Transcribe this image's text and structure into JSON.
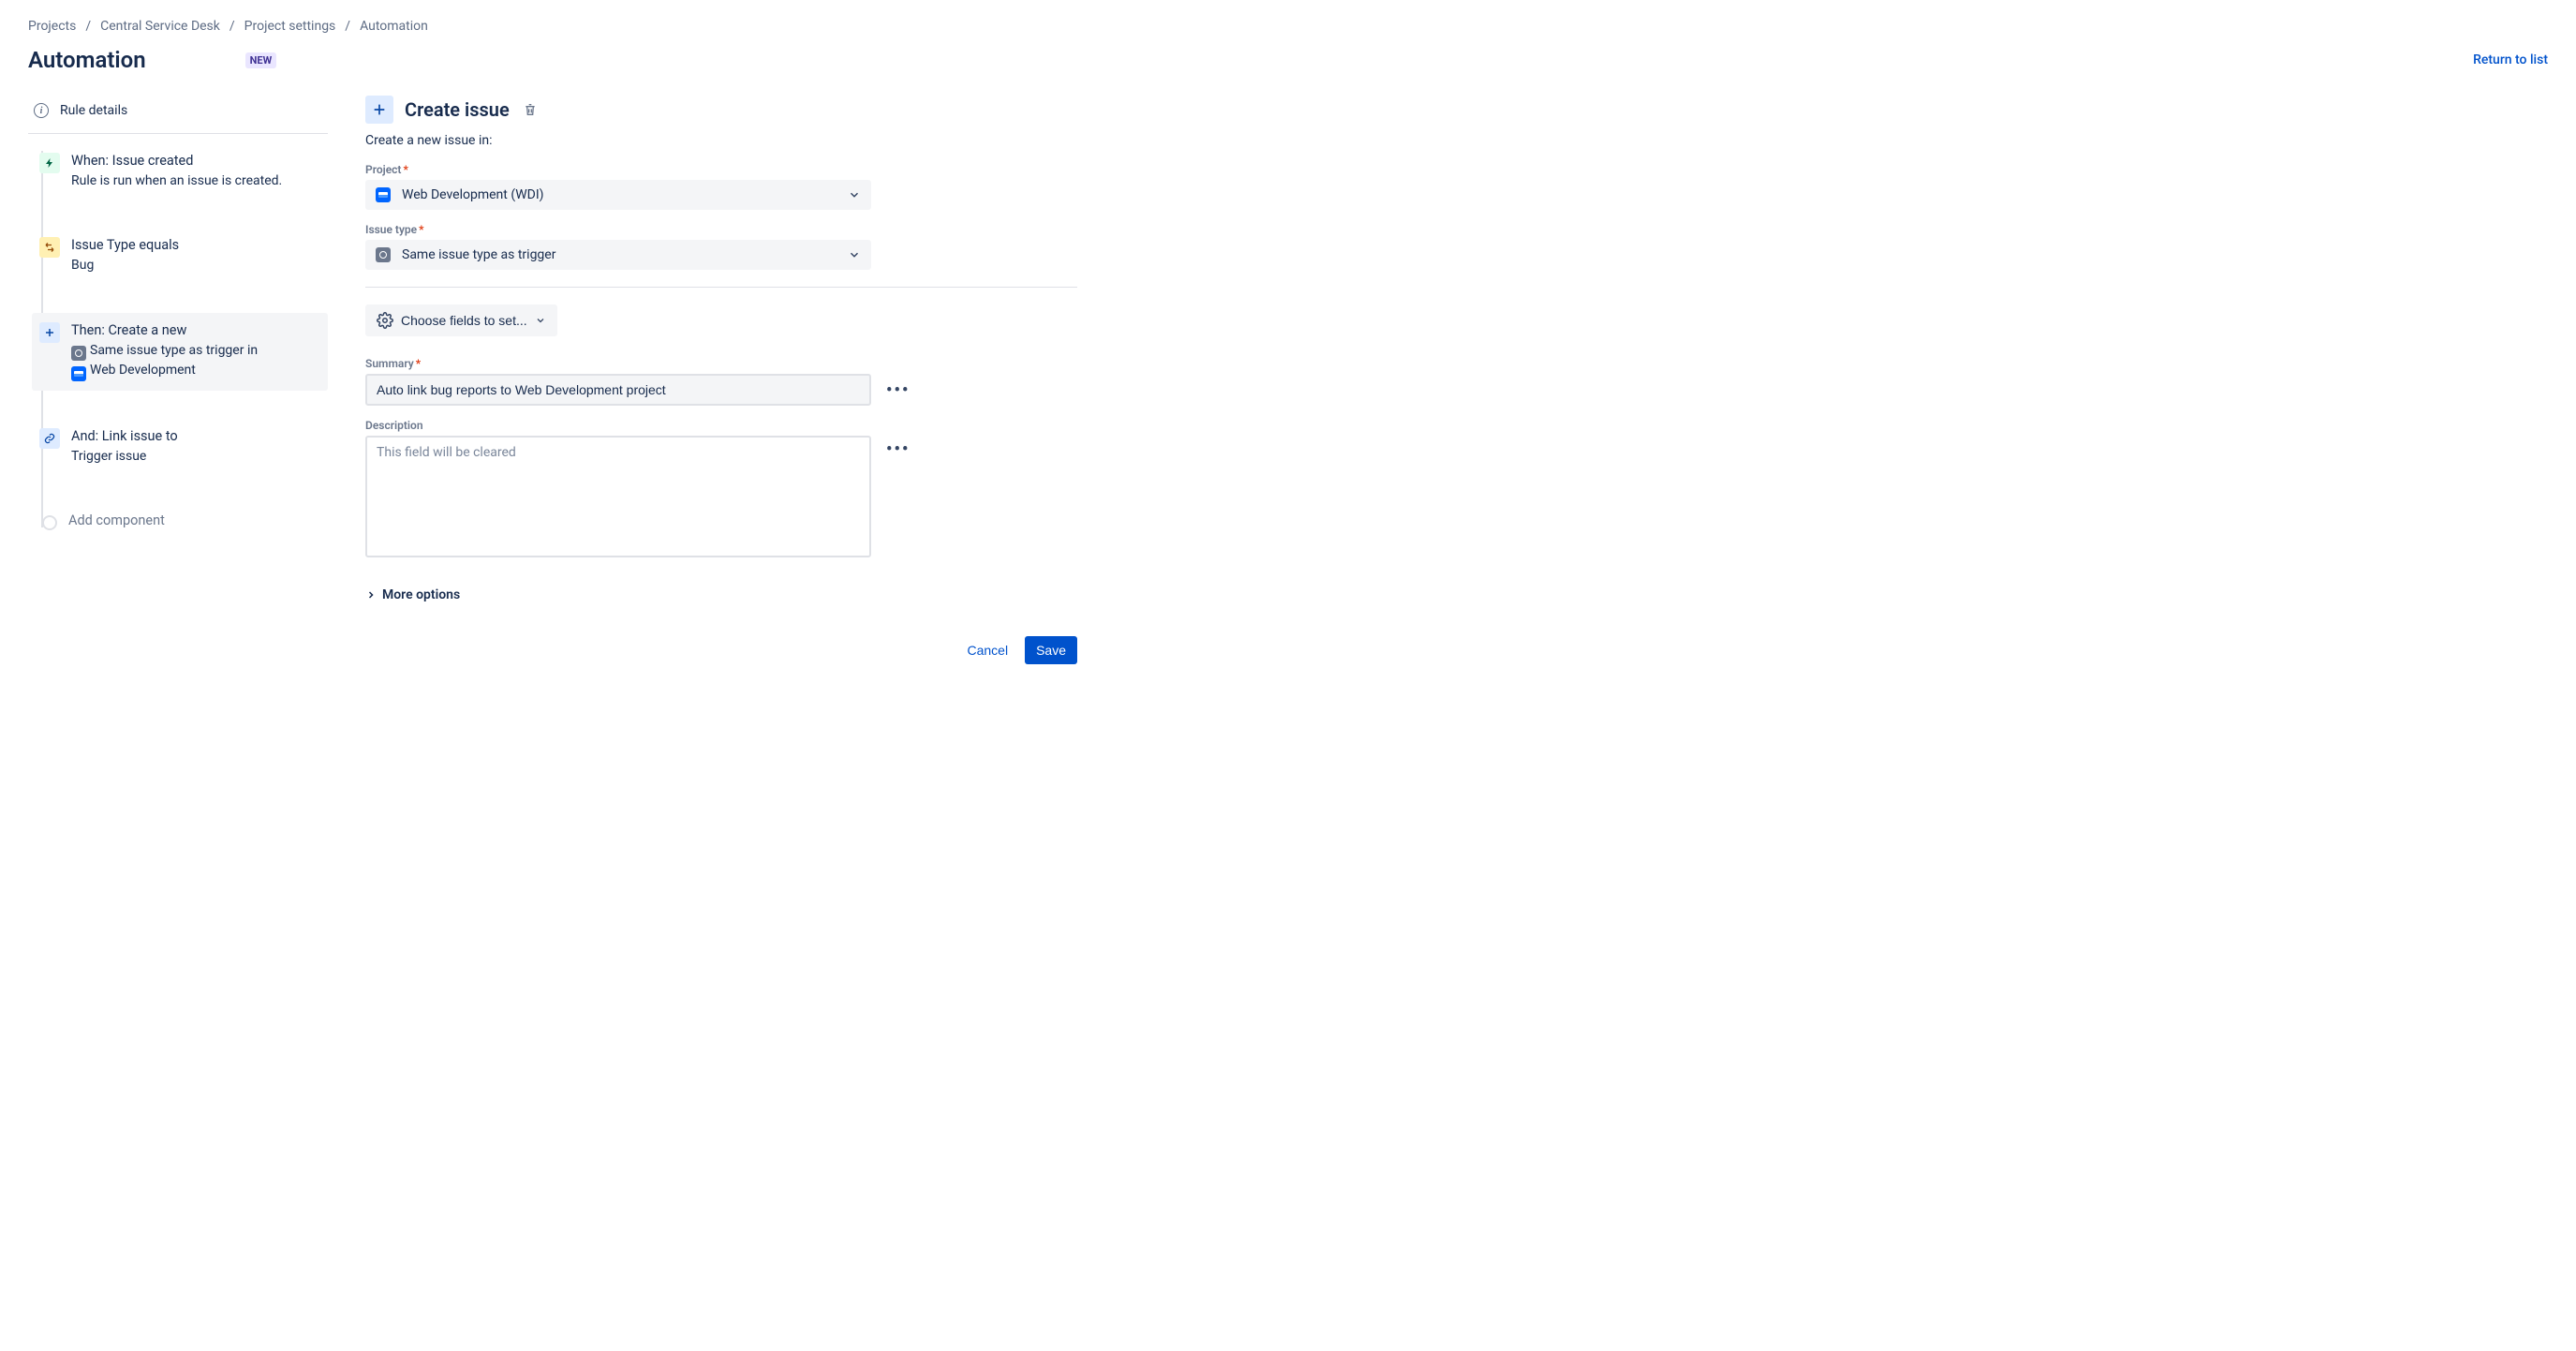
{
  "breadcrumb": {
    "projects": "Projects",
    "servicedesk": "Central Service Desk",
    "settings": "Project settings",
    "automation": "Automation"
  },
  "header": {
    "title": "Automation",
    "new_lozenge": "NEW",
    "return_link": "Return to list"
  },
  "sidebar": {
    "rule_details": "Rule details",
    "steps": [
      {
        "title": "When: Issue created",
        "subtitle": "Rule is run when an issue is created."
      },
      {
        "title": "Issue Type equals",
        "subtitle": "Bug"
      },
      {
        "title": "Then: Create a new",
        "sub_prefix": "Same issue type as trigger in",
        "sub_project": "Web Development"
      },
      {
        "title": "And: Link issue to",
        "subtitle": "Trigger issue"
      }
    ],
    "add_component": "Add component"
  },
  "panel": {
    "title": "Create issue",
    "subtitle": "Create a new issue in:",
    "project_label": "Project",
    "project_value": "Web Development (WDI)",
    "issuetype_label": "Issue type",
    "issuetype_value": "Same issue type as trigger",
    "choose_fields": "Choose fields to set...",
    "summary_label": "Summary",
    "summary_value": "Auto link bug reports to Web Development project",
    "description_label": "Description",
    "description_placeholder": "This field will be cleared",
    "more_options": "More options",
    "cancel": "Cancel",
    "save": "Save"
  }
}
